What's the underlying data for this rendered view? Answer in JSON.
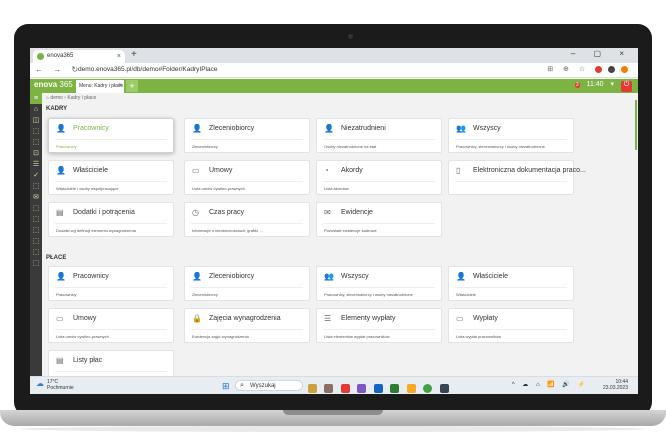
{
  "browser": {
    "tab_title": "enova365",
    "tab_close": "×",
    "new_tab": "+",
    "window_controls": "– ▢ ×",
    "nav_icons": "← → ↻",
    "url": "demo.enova365.pl/db/demo#Folder/KadryIPlace",
    "ext_icons": "⊞ ⊕ ☆"
  },
  "app": {
    "logo_a": "en",
    "logo_b": "o",
    "logo_c": "va",
    "logo_version": "365",
    "tab_label": "Menu: Kadry i płace",
    "tab_close": "×",
    "plus": "+",
    "badge_count": "3",
    "time": "11:40",
    "tool_icons": "▾",
    "power_icon": "⏻",
    "breadcrumb": "⌂ demo  ›  Kadry i płace"
  },
  "sidebar": {
    "icons": [
      "≡",
      "⌂",
      "◫",
      "⬚",
      "⬚",
      "⊡",
      "☰",
      "✓",
      "⬚",
      "✉",
      "⬚",
      "⬚",
      "⬚",
      "⬚",
      "⬚",
      "⬚"
    ]
  },
  "sections": {
    "kadry": "KADRY",
    "place": "PŁACE"
  },
  "kadry_cards": [
    {
      "icon": "👤",
      "title": "Pracownicy",
      "desc": "Pracownicy",
      "active": true
    },
    {
      "icon": "👤",
      "title": "Zleceniobiorcy",
      "desc": "Zleceniobiorcy"
    },
    {
      "icon": "👤",
      "title": "Niezatrudnieni",
      "desc": "Osoby niezatrudnione na etat"
    },
    {
      "icon": "👥",
      "title": "Wszyscy",
      "desc": "Pracownicy, zleceniobiorcy i osoby niezatrudnione"
    },
    {
      "icon": "👤",
      "title": "Właściciele",
      "desc": "Właściciele i osoby współpracujące"
    },
    {
      "icon": "▭",
      "title": "Umowy",
      "desc": "Lista umów cywilno-prawnych"
    },
    {
      "icon": "◔",
      "title": "Akordy",
      "desc": "Lista akordów"
    },
    {
      "icon": "▯",
      "title": "Elektroniczna dokumentacja praco...",
      "desc": ""
    },
    {
      "icon": "▤",
      "title": "Dodatki i potrącenia",
      "desc": "Dodatki wg definicji elementu wynagrodzenia"
    },
    {
      "icon": "◷",
      "title": "Czas pracy",
      "desc": "Informacje o nieobecnościach, grafiki, ..."
    },
    {
      "icon": "✉",
      "title": "Ewidencje",
      "desc": "Pozostałe ewidencje kadrowe"
    }
  ],
  "place_cards": [
    {
      "icon": "👤",
      "title": "Pracownicy",
      "desc": "Pracownicy"
    },
    {
      "icon": "👤",
      "title": "Zleceniobiorcy",
      "desc": "Zleceniobiorcy"
    },
    {
      "icon": "👥",
      "title": "Wszyscy",
      "desc": "Pracownicy, zleceniobiorcy i osoby niezatrudnione"
    },
    {
      "icon": "👤",
      "title": "Właściciele",
      "desc": "Właściciele"
    },
    {
      "icon": "▭",
      "title": "Umowy",
      "desc": "Lista umów cywilno-prawnych"
    },
    {
      "icon": "🔒",
      "title": "Zajęcia wynagrodzenia",
      "desc": "Ewidencja zajęć wynagrodzenia"
    },
    {
      "icon": "☰",
      "title": "Elementy wypłaty",
      "desc": "Lista elementów wypłat pracowników"
    },
    {
      "icon": "▭",
      "title": "Wypłaty",
      "desc": "Lista wypłat pracowników"
    },
    {
      "icon": "▤",
      "title": "Listy płac",
      "desc": ""
    }
  ],
  "taskbar": {
    "weather_temp": "17°C",
    "weather_desc": "Pochmurnie",
    "search_label": "Wyszukaj",
    "tray": "^ ☁ ⌂ 📶 🔊 ⚡",
    "time": "10:44",
    "date": "23.03.2023"
  },
  "colors": {
    "brand_green": "#7cb342",
    "sidebar": "#3a3a3a",
    "power_red": "#e53935"
  }
}
